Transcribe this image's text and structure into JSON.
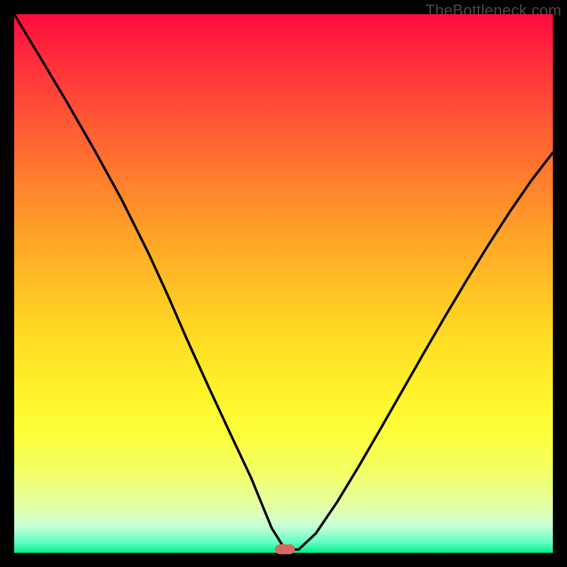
{
  "watermark": {
    "text": "TheBottleneck.com"
  },
  "marker": {
    "color": "#d56a63",
    "x_frac": 0.503,
    "y_frac": 0.994
  },
  "chart_data": {
    "type": "line",
    "title": "",
    "xlabel": "",
    "ylabel": "",
    "xlim": [
      0,
      1
    ],
    "ylim": [
      0,
      1
    ],
    "grid": false,
    "legend": false,
    "series": [
      {
        "name": "bottleneck-curve",
        "x": [
          0.0,
          0.05,
          0.1,
          0.15,
          0.2,
          0.25,
          0.286,
          0.32,
          0.36,
          0.4,
          0.44,
          0.478,
          0.503,
          0.528,
          0.56,
          0.6,
          0.64,
          0.68,
          0.72,
          0.76,
          0.8,
          0.84,
          0.88,
          0.92,
          0.96,
          1.0
        ],
        "y": [
          1.0,
          0.917,
          0.833,
          0.746,
          0.655,
          0.555,
          0.476,
          0.398,
          0.31,
          0.224,
          0.139,
          0.046,
          0.006,
          0.006,
          0.036,
          0.095,
          0.161,
          0.23,
          0.3,
          0.37,
          0.439,
          0.506,
          0.571,
          0.633,
          0.691,
          0.743
        ]
      }
    ],
    "annotations": [
      {
        "type": "marker",
        "x": 0.503,
        "y": 0.006,
        "color": "#d56a63",
        "shape": "pill"
      }
    ]
  }
}
